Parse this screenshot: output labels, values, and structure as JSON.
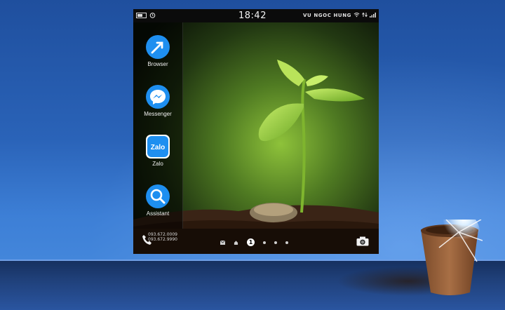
{
  "statusbar": {
    "time": "18:42",
    "carrier": "VU NGOC HUNG"
  },
  "dock": {
    "apps": [
      {
        "label": "Browser",
        "icon": "browser-icon"
      },
      {
        "label": "Messenger",
        "icon": "messenger-icon"
      },
      {
        "label": "Zalo",
        "icon": "zalo-icon",
        "icon_text": "Zalo"
      },
      {
        "label": "Assistant",
        "icon": "assistant-icon"
      }
    ]
  },
  "bottombar": {
    "phone_numbers": [
      "093.672.0009",
      "093.672.9990"
    ],
    "active_page": "1"
  },
  "colors": {
    "accent_blue": "#1e8ff0",
    "desktop_bg": "#2a63b8"
  }
}
